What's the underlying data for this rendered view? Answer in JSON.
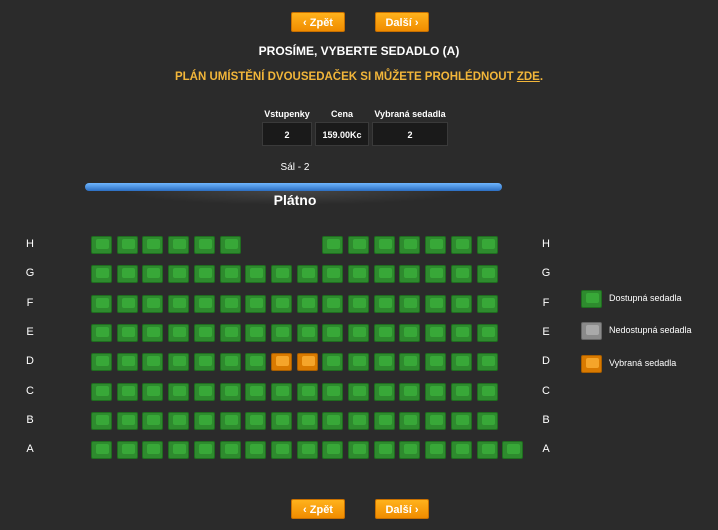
{
  "nav": {
    "back_label": "Zpět",
    "next_label": "Další"
  },
  "header": {
    "title": "PROSÍME, VYBERTE SEDADLO (A)",
    "subtitle_text": "PLÁN UMÍSTĚNÍ DVOUSEDAČEK SI MŮŽETE PROHLÉDNOUT ",
    "subtitle_link": "ZDE",
    "subtitle_end": "."
  },
  "info": {
    "tickets_label": "Vstupenky",
    "tickets_value": "2",
    "price_label": "Cena",
    "price_value": "159.00Kc",
    "selected_label": "Vybraná sedadla",
    "selected_value": "2"
  },
  "hall": {
    "name": "Sál - 2",
    "screen_label": "Plátno"
  },
  "rows": [
    {
      "label": "H",
      "seats": [
        "a",
        "a",
        "a",
        "a",
        "a",
        "a",
        null,
        null,
        null,
        "a",
        "a",
        "a",
        "a",
        "a",
        "a",
        "a"
      ]
    },
    {
      "label": "G",
      "seats": [
        "a",
        "a",
        "a",
        "a",
        "a",
        "a",
        "a",
        "a",
        "a",
        "a",
        "a",
        "a",
        "a",
        "a",
        "a",
        "a"
      ]
    },
    {
      "label": "F",
      "seats": [
        "a",
        "a",
        "a",
        "a",
        "a",
        "a",
        "a",
        "a",
        "a",
        "a",
        "a",
        "a",
        "a",
        "a",
        "a",
        "a"
      ]
    },
    {
      "label": "E",
      "seats": [
        "a",
        "a",
        "a",
        "a",
        "a",
        "a",
        "a",
        "a",
        "a",
        "a",
        "a",
        "a",
        "a",
        "a",
        "a",
        "a"
      ]
    },
    {
      "label": "D",
      "seats": [
        "a",
        "a",
        "a",
        "a",
        "a",
        "a",
        "a",
        "s",
        "s",
        "a",
        "a",
        "a",
        "a",
        "a",
        "a",
        "a"
      ]
    },
    {
      "label": "C",
      "seats": [
        "a",
        "a",
        "a",
        "a",
        "a",
        "a",
        "a",
        "a",
        "a",
        "a",
        "a",
        "a",
        "a",
        "a",
        "a",
        "a"
      ]
    },
    {
      "label": "B",
      "seats": [
        "a",
        "a",
        "a",
        "a",
        "a",
        "a",
        "a",
        "a",
        "a",
        "a",
        "a",
        "a",
        "a",
        "a",
        "a",
        "a"
      ]
    },
    {
      "label": "A",
      "seats": [
        "a",
        "a",
        "a",
        "a",
        "a",
        "a",
        "a",
        "a",
        "a",
        "a",
        "a",
        "a",
        "a",
        "a",
        "a",
        "a",
        "a"
      ]
    }
  ],
  "legend": {
    "available": "Dostupná sedadla",
    "unavailable": "Nedostupná sedadla",
    "selected": "Vybraná sedadla"
  },
  "colors": {
    "accent": "#f39c12",
    "available": "#2e8b2e",
    "selected": "#d97a00",
    "unavailable": "#8a8a8a",
    "screen": "#3a86d6"
  }
}
